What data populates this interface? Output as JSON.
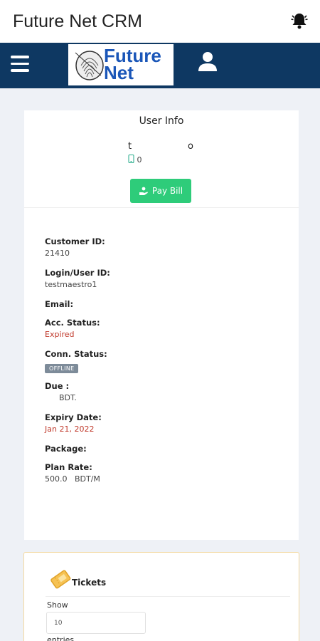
{
  "app": {
    "title": "Future Net CRM"
  },
  "logo": {
    "line1": "Future",
    "line2": "Net"
  },
  "user_info": {
    "heading": "User Info",
    "name_left": "t",
    "name_right": "o",
    "phone": "0",
    "pay_button": "Pay Bill",
    "fields": [
      {
        "label": "Customer ID:",
        "value": "21410"
      },
      {
        "label": "Login/User ID:",
        "value": "testmaestro1"
      },
      {
        "label": "Email:",
        "value": ""
      },
      {
        "label": "Acc. Status:",
        "value": "Expired"
      },
      {
        "label": "Conn. Status:",
        "badge": "OFFLINE"
      },
      {
        "label": "Due :",
        "value": "BDT."
      },
      {
        "label": "Expiry Date:",
        "value": "Jan 21, 2022"
      },
      {
        "label": "Package:",
        "value": ""
      },
      {
        "label": "Plan Rate:",
        "value": "500.0   BDT/M"
      }
    ]
  },
  "tickets": {
    "title": "Tickets",
    "show_label": "Show",
    "entries_value": "10",
    "entries_label": "entries"
  },
  "colors": {
    "navbar": "#0e3862",
    "pay_button": "#2ecc7a",
    "expired": "#c0392b"
  }
}
